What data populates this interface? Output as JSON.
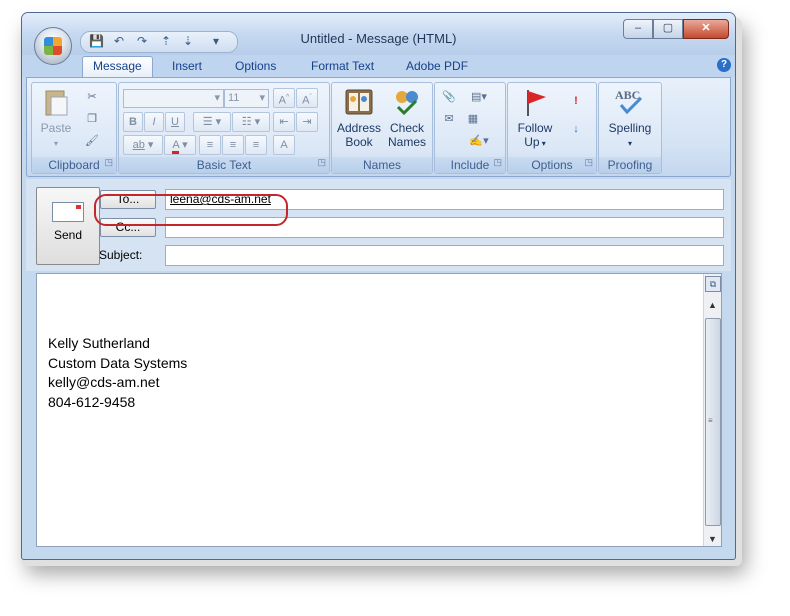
{
  "window": {
    "title": "Untitled - Message (HTML)",
    "controls": {
      "minimize": "–",
      "maximize": "▢",
      "close": "✕"
    }
  },
  "quick_access": {
    "save": "💾",
    "undo": "↶",
    "redo": "↷",
    "up": "⇡",
    "down": "⇣",
    "more": "▾"
  },
  "tabs": [
    "Message",
    "Insert",
    "Options",
    "Format Text",
    "Adobe PDF"
  ],
  "ribbon": {
    "clipboard": {
      "label": "Clipboard",
      "paste": "Paste"
    },
    "basic_text": {
      "label": "Basic Text",
      "font_size": "11",
      "bold": "B",
      "italic": "I",
      "underline": "U"
    },
    "names": {
      "label": "Names",
      "address_book_1": "Address",
      "address_book_2": "Book",
      "check_names_1": "Check",
      "check_names_2": "Names"
    },
    "include": {
      "label": "Include"
    },
    "options": {
      "label": "Options",
      "follow_up_1": "Follow",
      "follow_up_2": "Up"
    },
    "proofing": {
      "label": "Proofing",
      "spelling": "Spelling",
      "abc": "ABC"
    }
  },
  "header": {
    "send_label": "Send",
    "to_label": "To...",
    "cc_label": "Cc...",
    "subject_label": "Subject:",
    "to_value": "leena@cds-am.net",
    "cc_value": "",
    "subject_value": ""
  },
  "body": {
    "signature": [
      "Kelly Sutherland",
      "Custom Data Systems",
      "kelly@cds-am.net",
      "804-612-9458"
    ]
  },
  "colors": {
    "highlight_oval": "#c2272d",
    "ribbon_label": "#3e5f8e"
  }
}
